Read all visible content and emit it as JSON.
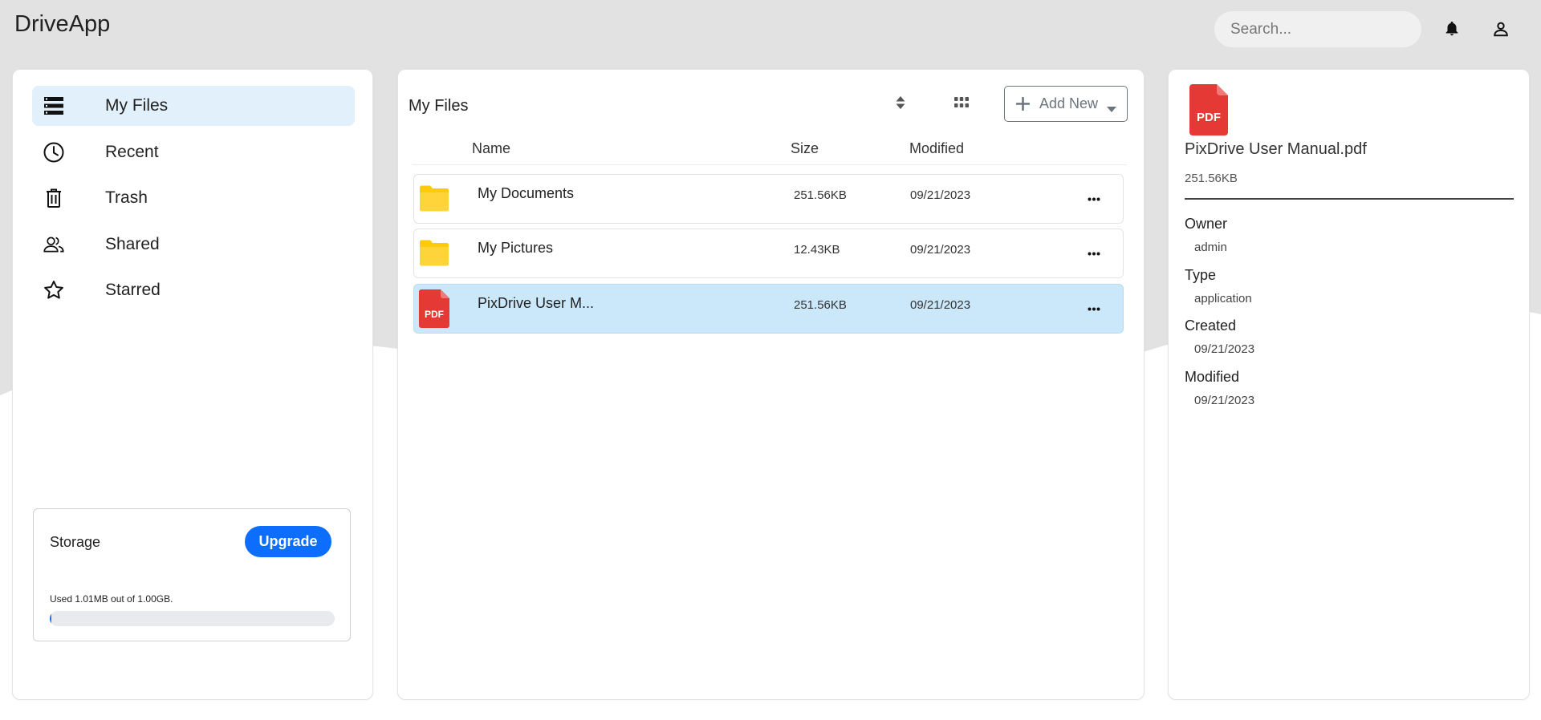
{
  "app": {
    "title": "DriveApp"
  },
  "header": {
    "search_placeholder": "Search...",
    "bell_icon": "bell-icon",
    "user_icon": "user-icon"
  },
  "sidebar": {
    "items": [
      {
        "label": "My Files",
        "icon": "storage-list-icon",
        "active": true
      },
      {
        "label": "Recent",
        "icon": "clock-icon",
        "active": false
      },
      {
        "label": "Trash",
        "icon": "trash-icon",
        "active": false
      },
      {
        "label": "Shared",
        "icon": "people-icon",
        "active": false
      },
      {
        "label": "Starred",
        "icon": "star-icon",
        "active": false
      }
    ],
    "storage": {
      "title": "Storage",
      "upgrade_label": "Upgrade",
      "used_text": "Used 1.01MB out of 1.00GB.",
      "used_fraction": 0.001
    }
  },
  "files": {
    "title": "My Files",
    "add_new_label": "Add New",
    "columns": {
      "name": "Name",
      "size": "Size",
      "modified": "Modified"
    },
    "rows": [
      {
        "name": "My Documents",
        "size": "251.56KB",
        "modified": "09/21/2023",
        "type": "folder",
        "selected": false
      },
      {
        "name": "My Pictures",
        "size": "12.43KB",
        "modified": "09/21/2023",
        "type": "folder",
        "selected": false
      },
      {
        "name": "PixDrive User M...",
        "size": "251.56KB",
        "modified": "09/21/2023",
        "type": "pdf",
        "selected": true
      }
    ]
  },
  "details": {
    "file_name": "PixDrive User Manual.pdf",
    "file_size": "251.56KB",
    "pdf_badge": "PDF",
    "owner_label": "Owner",
    "owner": "admin",
    "type_label": "Type",
    "type": "application",
    "created_label": "Created",
    "created": "09/21/2023",
    "modified_label": "Modified",
    "modified": "09/21/2023"
  },
  "colors": {
    "accent": "#0d6efd",
    "active_nav_bg": "#e2f0fb",
    "selected_row_bg": "#cbe7fa",
    "folder": "#ffca0a",
    "pdf": "#e53935",
    "header_bg": "#e2e2e2"
  }
}
